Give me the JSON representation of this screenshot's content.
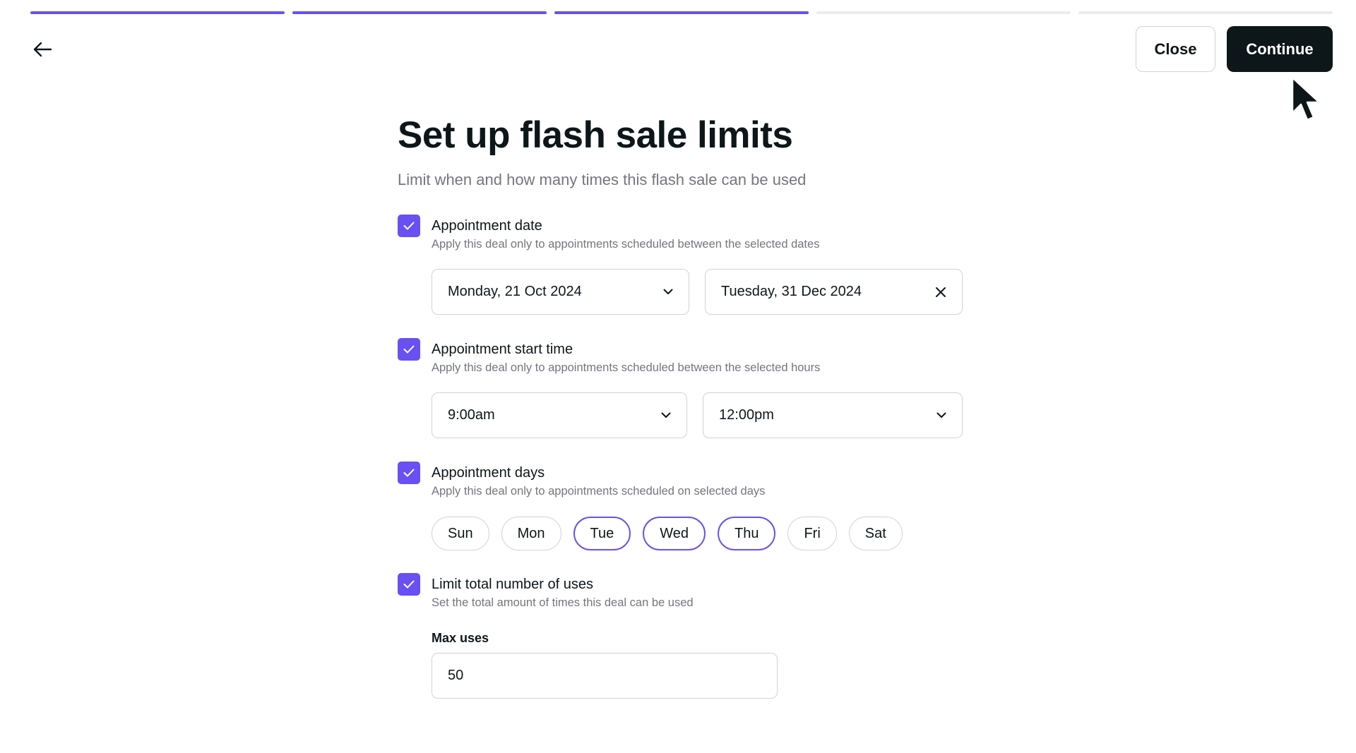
{
  "progress": {
    "total_steps": 5,
    "completed_steps": 3
  },
  "header": {
    "close_label": "Close",
    "continue_label": "Continue"
  },
  "page": {
    "title": "Set up flash sale limits",
    "subtitle": "Limit when and how many times this flash sale can be used"
  },
  "sections": {
    "date": {
      "checked": true,
      "title": "Appointment date",
      "description": "Apply this deal only to appointments scheduled between the selected dates",
      "start_value": "Monday, 21 Oct 2024",
      "end_value": "Tuesday, 31 Dec 2024"
    },
    "time": {
      "checked": true,
      "title": "Appointment start time",
      "description": "Apply this deal only to appointments scheduled between the selected hours",
      "start_value": "9:00am",
      "end_value": "12:00pm"
    },
    "days": {
      "checked": true,
      "title": "Appointment days",
      "description": "Apply this deal only to appointments scheduled on selected days",
      "items": [
        {
          "label": "Sun",
          "selected": false
        },
        {
          "label": "Mon",
          "selected": false
        },
        {
          "label": "Tue",
          "selected": true
        },
        {
          "label": "Wed",
          "selected": true
        },
        {
          "label": "Thu",
          "selected": true
        },
        {
          "label": "Fri",
          "selected": false
        },
        {
          "label": "Sat",
          "selected": false
        }
      ]
    },
    "uses": {
      "checked": true,
      "title": "Limit total number of uses",
      "description": "Set the total amount of times this deal can be used",
      "max_label": "Max uses",
      "max_value": "50"
    }
  },
  "colors": {
    "accent": "#6950f3",
    "dark": "#0d1619",
    "muted_text": "#75757f",
    "border": "#d3d3d8"
  },
  "icons": [
    "arrow-left-icon",
    "check-icon",
    "chevron-down-icon",
    "close-x-icon",
    "mouse-cursor-icon"
  ]
}
